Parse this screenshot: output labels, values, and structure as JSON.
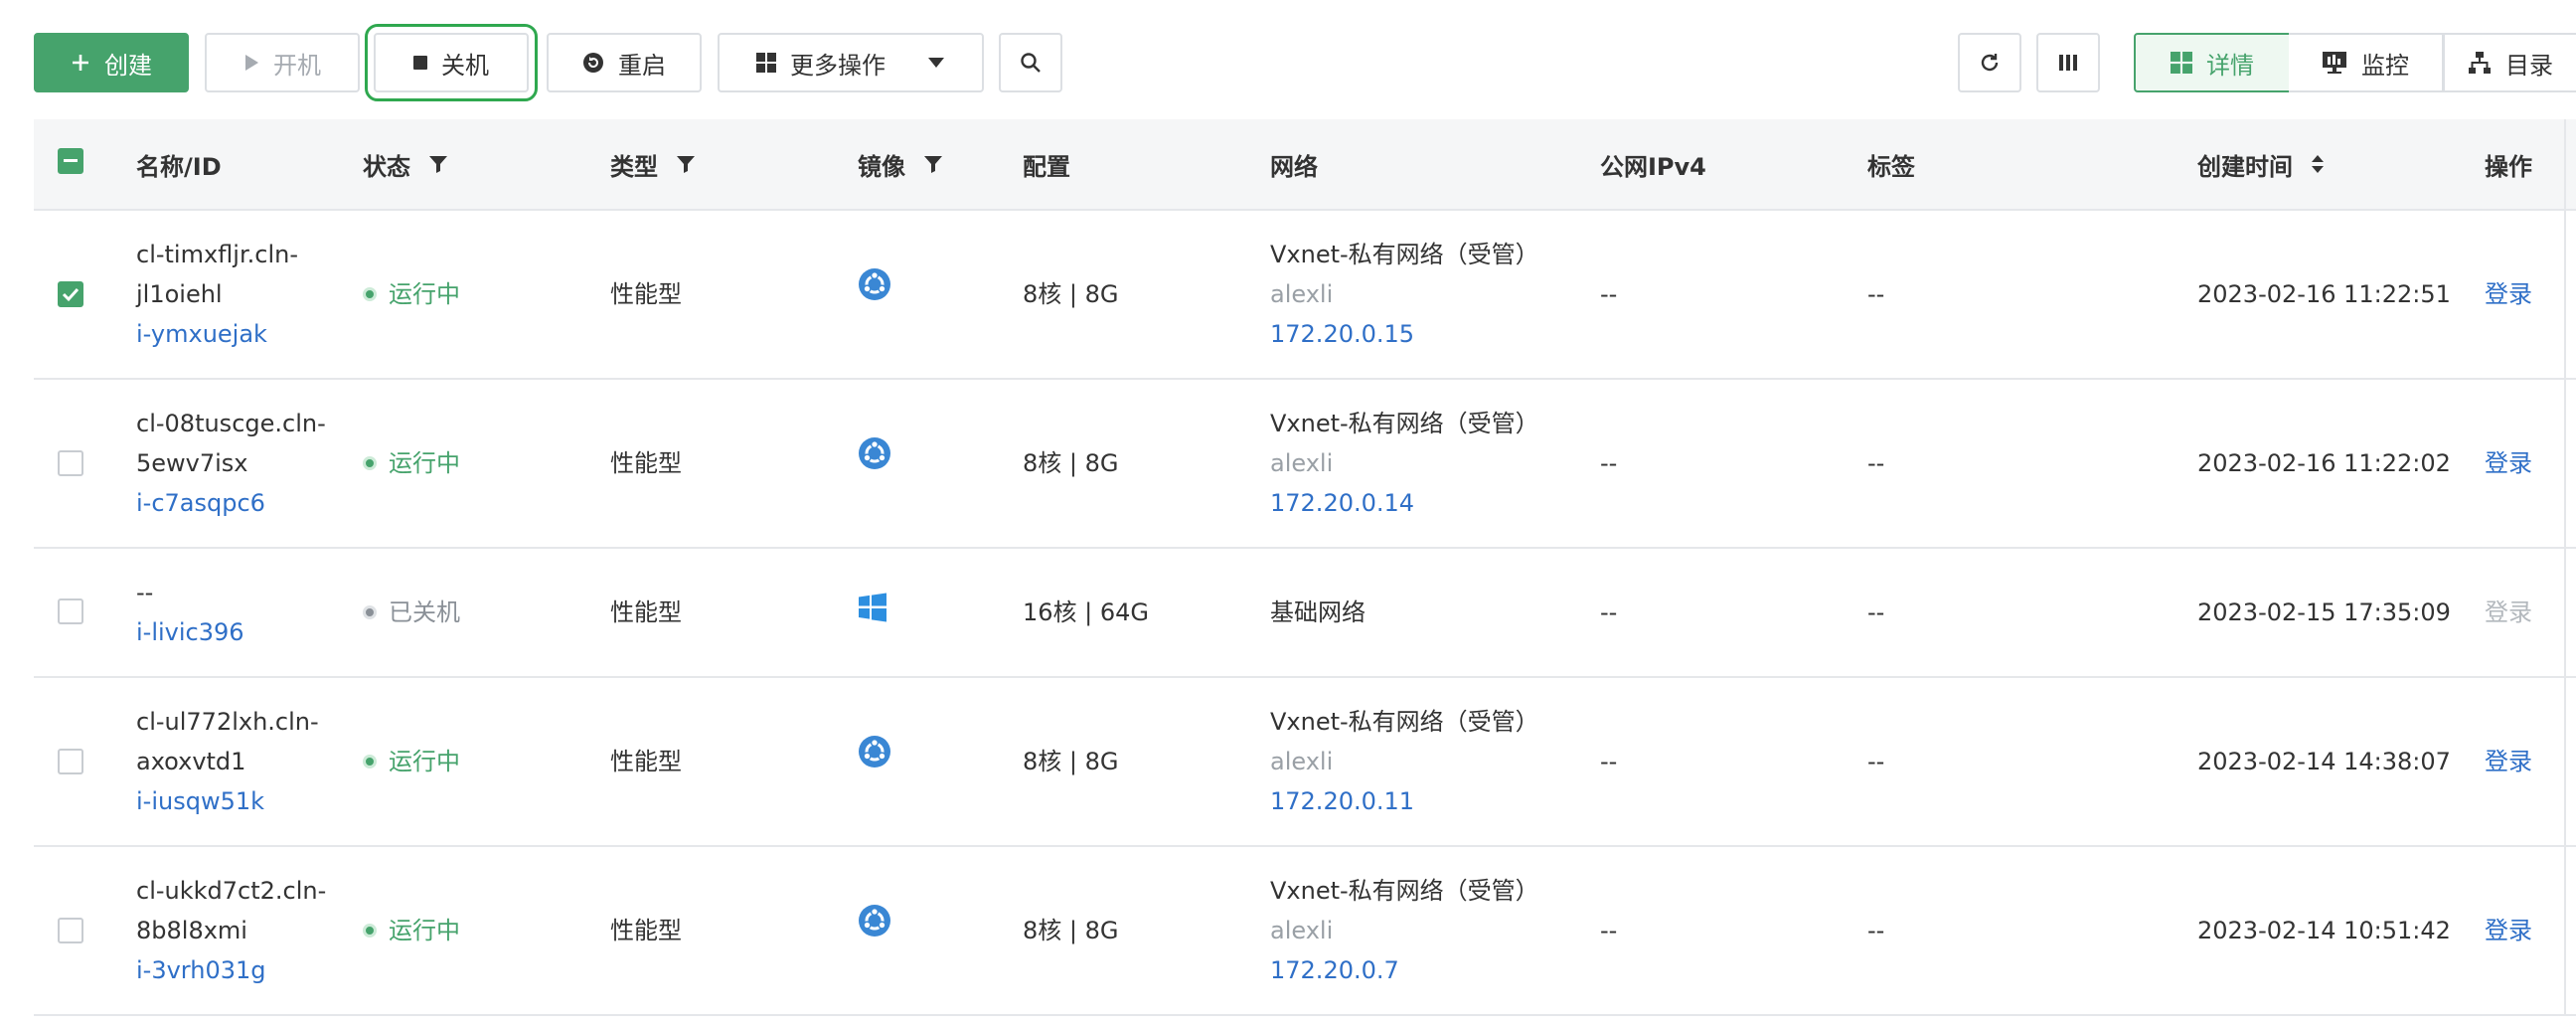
{
  "toolbar": {
    "create": "创建",
    "start": "开机",
    "stop": "关机",
    "restart": "重启",
    "more": "更多操作",
    "view_details": "详情",
    "view_monitor": "监控",
    "view_catalog": "目录"
  },
  "table": {
    "headers": {
      "name": "名称/ID",
      "status": "状态",
      "type": "类型",
      "image": "镜像",
      "config": "配置",
      "network": "网络",
      "ipv4": "公网IPv4",
      "tags": "标签",
      "created": "创建时间",
      "actions": "操作"
    },
    "rows": [
      {
        "name1": "cl-timxfljr.cln-",
        "name2": "jl1oiehl",
        "id": "i-ymxuejak",
        "status": "运行中",
        "type": "性能型",
        "image_icon": "ubuntu-icon",
        "config": "8核 | 8G",
        "net_name": "Vxnet-私有网络（受管）",
        "net_owner": "alexli",
        "net_ip": "172.20.0.15",
        "ipv4": "--",
        "tags": "--",
        "created": "2023-02-16 11:22:51",
        "action": "登录"
      },
      {
        "name1": "cl-08tuscge.cln-",
        "name2": "5ewv7isx",
        "id": "i-c7asqpc6",
        "status": "运行中",
        "type": "性能型",
        "image_icon": "ubuntu-icon",
        "config": "8核 | 8G",
        "net_name": "Vxnet-私有网络（受管）",
        "net_owner": "alexli",
        "net_ip": "172.20.0.14",
        "ipv4": "--",
        "tags": "--",
        "created": "2023-02-16 11:22:02",
        "action": "登录"
      },
      {
        "name1": "--",
        "id": "i-livic396",
        "status": "已关机",
        "type": "性能型",
        "image_icon": "windows-icon",
        "config": "16核 | 64G",
        "net_name": "基础网络",
        "ipv4": "--",
        "tags": "--",
        "created": "2023-02-15 17:35:09",
        "action": "登录"
      },
      {
        "name1": "cl-ul772lxh.cln-",
        "name2": "axoxvtd1",
        "id": "i-iusqw51k",
        "status": "运行中",
        "type": "性能型",
        "image_icon": "ubuntu-icon",
        "config": "8核 | 8G",
        "net_name": "Vxnet-私有网络（受管）",
        "net_owner": "alexli",
        "net_ip": "172.20.0.11",
        "ipv4": "--",
        "tags": "--",
        "created": "2023-02-14 14:38:07",
        "action": "登录"
      },
      {
        "name1": "cl-ukkd7ct2.cln-",
        "name2": "8b8l8xmi",
        "id": "i-3vrh031g",
        "status": "运行中",
        "type": "性能型",
        "image_icon": "ubuntu-icon",
        "config": "8核 | 8G",
        "net_name": "Vxnet-私有网络（受管）",
        "net_owner": "alexli",
        "net_ip": "172.20.0.7",
        "ipv4": "--",
        "tags": "--",
        "created": "2023-02-14 10:51:42",
        "action": "登录"
      }
    ]
  },
  "colors": {
    "accent": "#46a36c",
    "link": "#2f6fc7",
    "ubuntu": "#3a87d4",
    "windows": "#2d8fe0"
  }
}
